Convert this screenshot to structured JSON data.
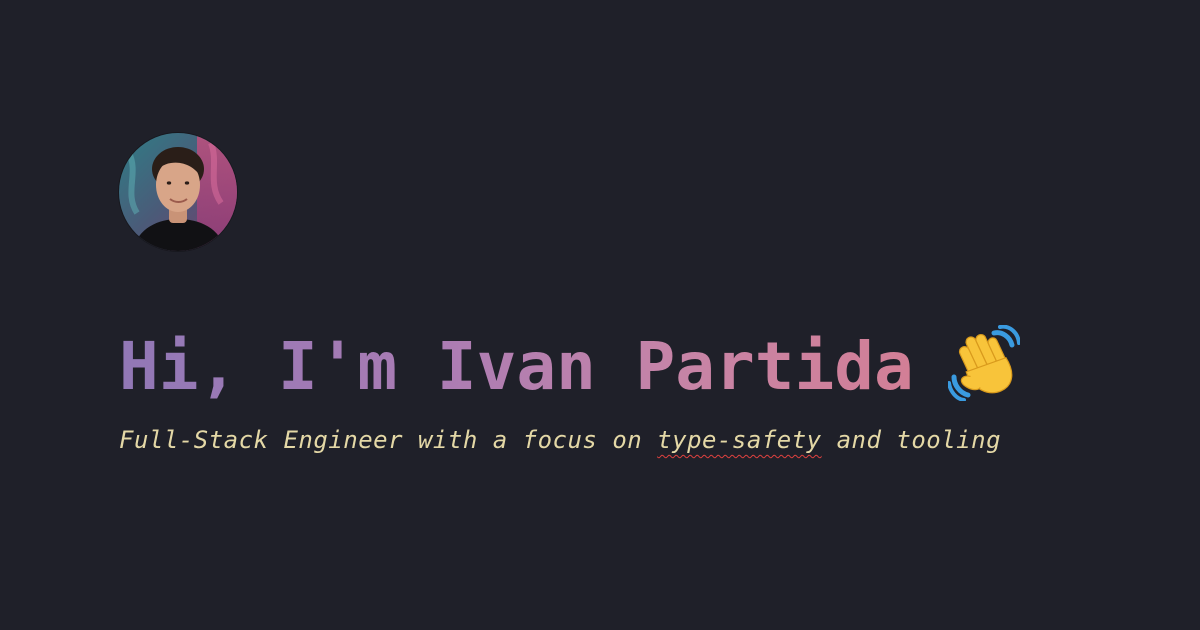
{
  "profile": {
    "avatar_icon": "profile-photo",
    "greeting": "Hi, I'm Ivan Partida",
    "wave_icon": "waving-hand-emoji",
    "subtitle_before": "Full-Stack Engineer with a focus on ",
    "subtitle_flagged": "type-safety",
    "subtitle_after": " and tooling"
  },
  "colors": {
    "background": "#1f2029",
    "greeting_gradient_start": "#9178b6",
    "greeting_gradient_end": "#d37f96",
    "subtitle": "#e4d8a6",
    "spellcheck_underline": "#e0413f"
  }
}
